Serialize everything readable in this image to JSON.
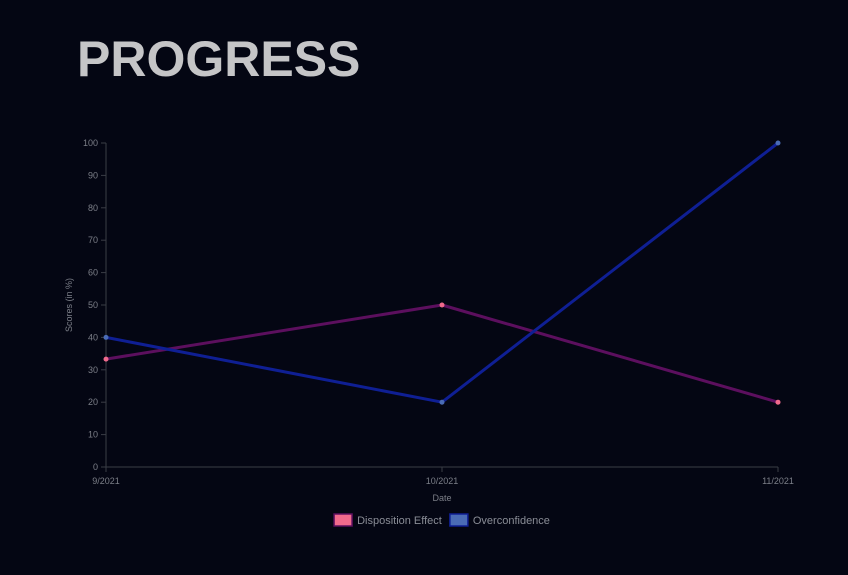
{
  "page": {
    "title": "PROGRESS"
  },
  "chart_data": {
    "type": "line",
    "categories": [
      "9/2021",
      "10/2021",
      "11/2021"
    ],
    "xlabel": "Date",
    "ylabel": "Scores (in %)",
    "ylim": [
      0,
      100
    ],
    "yticks": [
      0,
      10,
      20,
      30,
      40,
      50,
      60,
      70,
      80,
      90,
      100
    ],
    "grid": false,
    "legend_position": "bottom",
    "series": [
      {
        "name": "Disposition Effect",
        "values": [
          33.3,
          50,
          20
        ],
        "line_color": "#5c0f5e",
        "point_color": "#f06a8c",
        "legend_color": "#f06a8c"
      },
      {
        "name": "Overconfidence",
        "values": [
          40,
          20,
          100
        ],
        "line_color": "#0f1f94",
        "point_color": "#4a6bb5",
        "legend_color": "#4a6bb5"
      }
    ]
  }
}
